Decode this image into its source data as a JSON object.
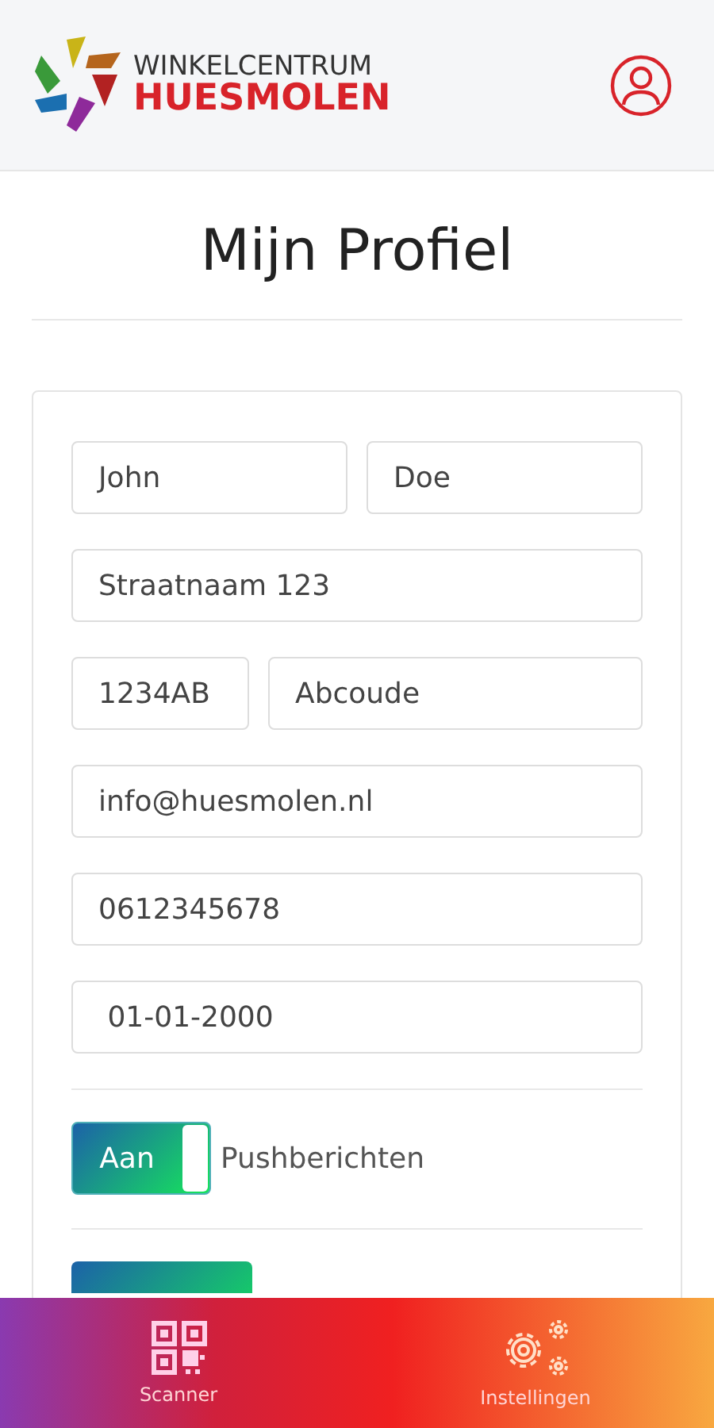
{
  "header": {
    "logo_top": "WINKELCENTRUM",
    "logo_bottom": "HUESMOLEN"
  },
  "title": "Mijn Profiel",
  "form": {
    "rows": [
      {
        "fields": [
          {
            "value": "John"
          },
          {
            "value": "Doe"
          }
        ]
      },
      {
        "fields": [
          {
            "value": "Straatnaam 123"
          }
        ]
      },
      {
        "fields": [
          {
            "value": "1234AB"
          },
          {
            "value": "Abcoude"
          }
        ]
      },
      {
        "fields": [
          {
            "value": "info@huesmolen.nl"
          }
        ]
      },
      {
        "fields": [
          {
            "value": "0612345678"
          }
        ]
      },
      {
        "fields": [
          {
            "value": " 01-01-2000"
          }
        ]
      }
    ],
    "toggle": {
      "state_label": "Aan",
      "on": true,
      "label": "Pushberichten"
    }
  },
  "nav": [
    {
      "kind": "scanner",
      "label": "Scanner"
    },
    {
      "kind": "settings",
      "label": "Instellingen"
    }
  ]
}
